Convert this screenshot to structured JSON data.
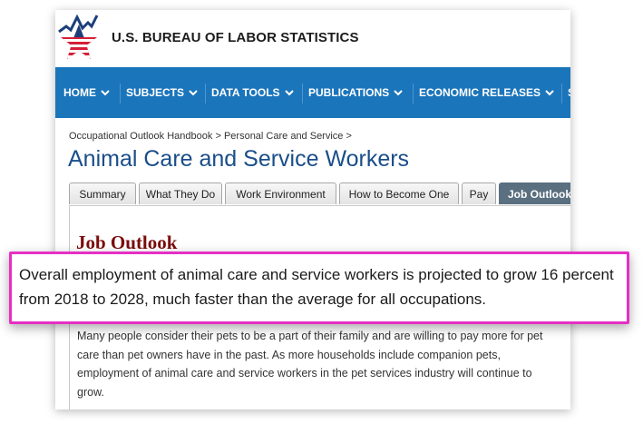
{
  "header": {
    "site_title": "U.S. BUREAU OF LABOR STATISTICS",
    "logo_icon": "bls-star-logo-icon"
  },
  "nav": {
    "items": [
      {
        "label": "HOME"
      },
      {
        "label": "SUBJECTS"
      },
      {
        "label": "DATA TOOLS"
      },
      {
        "label": "PUBLICATIONS"
      },
      {
        "label": "ECONOMIC RELEASES"
      },
      {
        "label": "S"
      }
    ],
    "background": "#1b75bb"
  },
  "breadcrumb": {
    "items": [
      "Occupational Outlook Handbook",
      "Personal Care and Service"
    ],
    "separator": ">"
  },
  "page": {
    "title": "Animal Care and Service Workers"
  },
  "tabs": [
    {
      "label": "Summary",
      "active": false
    },
    {
      "label": "What They Do",
      "active": false
    },
    {
      "label": "Work Environment",
      "active": false
    },
    {
      "label": "How to Become One",
      "active": false
    },
    {
      "label": "Pay",
      "active": false
    },
    {
      "label": "Job Outlook",
      "active": true
    }
  ],
  "section": {
    "title": "Job Outlook",
    "body": "Many people consider their pets to be a part of their family and are willing to pay more for pet care than pet owners have in the past. As more households include companion pets, employment of animal care and service workers in the pet services industry will continue to grow."
  },
  "callout": {
    "text": "Overall employment of animal care and service workers is projected to grow 16 percent from 2018 to 2028, much faster than the average for all occupations.",
    "border_color": "#e62fc4"
  }
}
